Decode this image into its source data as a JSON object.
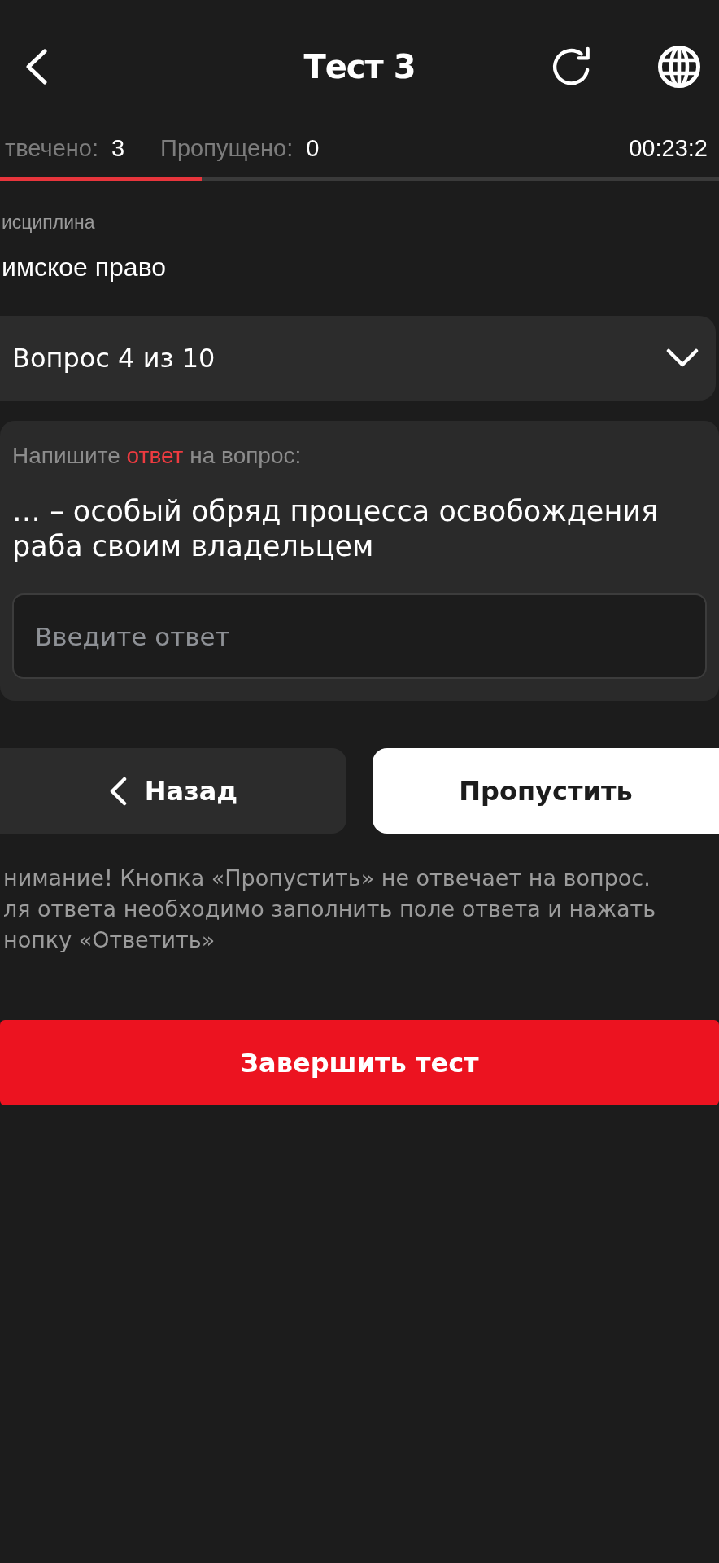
{
  "header": {
    "title": "Тест 3"
  },
  "stats": [
    {
      "label": "твечено:",
      "value": "3"
    },
    {
      "label": "Пропущено:",
      "value": "0"
    }
  ],
  "timer": "00:23:2",
  "progress": {
    "level": 0.28
  },
  "discipline": {
    "label": "исциплина",
    "value": "имское право"
  },
  "question_selector": {
    "label": "Вопрос 4 из 10",
    "expanded": false
  },
  "question_card": {
    "prompt_parts": [
      {
        "text": "Напишите",
        "kind": "plain"
      },
      {
        "text": "ответ",
        "kind": "accent"
      },
      {
        "text": "на вопрос:",
        "kind": "plain"
      }
    ],
    "question": "… – особый обряд процесса освобождения раба своим владельцем",
    "answer_field": {
      "placeholder": "Введите ответ"
    }
  },
  "buttons": [
    {
      "label": "Назад",
      "kind": "back"
    },
    {
      "label": "Пропустить",
      "kind": "skip"
    }
  ],
  "notice_lines": [
    "нимание! Кнопка «Пропустить» не отвечает на вопрос.",
    "ля ответа необходимо заполнить поле ответа и нажать",
    "нопку «Ответить»"
  ],
  "finish_button": {
    "label": "Завершить тест"
  }
}
